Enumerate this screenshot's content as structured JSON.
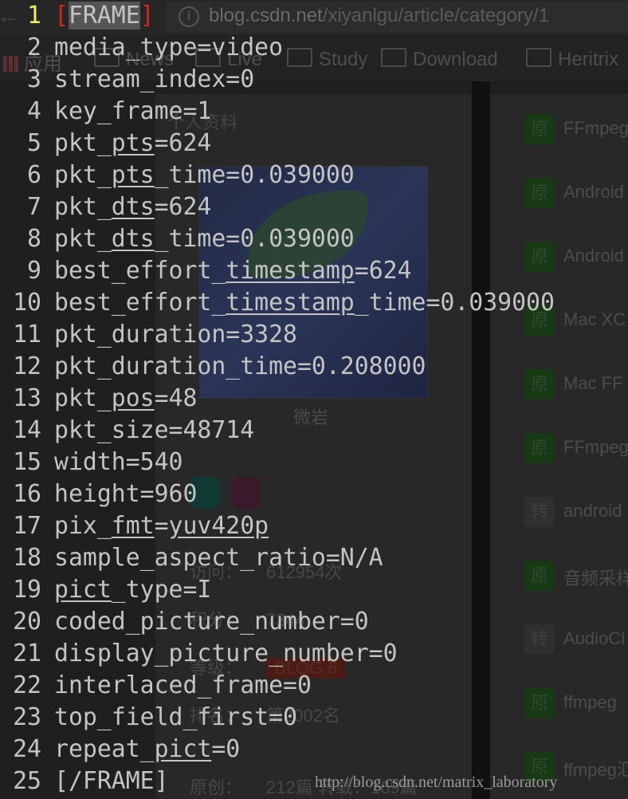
{
  "browser": {
    "url_host": "blog.csdn.net",
    "url_path": "/xiyanlgu/article/category/1",
    "bookmarks": [
      {
        "label": "应用",
        "icon": "apps-icon"
      },
      {
        "label": "News",
        "icon": "folder-icon"
      },
      {
        "label": "Live",
        "icon": "folder-icon"
      },
      {
        "label": "Study",
        "icon": "folder-icon"
      },
      {
        "label": "Download",
        "icon": "folder-icon"
      },
      {
        "label": "Heritrix",
        "icon": "folder-icon"
      }
    ],
    "profile": {
      "title": "个人资料",
      "name": "微岩",
      "stats": [
        {
          "label": "访问：",
          "value": "612954次"
        },
        {
          "label": "积分：",
          "value": "7344"
        },
        {
          "label": "等级：",
          "value": "BLOG 6"
        },
        {
          "label": "排名：",
          "value": "第2002名"
        },
        {
          "label": "原创：",
          "value": "212篇 转载：169篇"
        }
      ]
    },
    "articles": [
      {
        "badge": "原",
        "title": "FFmpeg"
      },
      {
        "badge": "原",
        "title": "Android"
      },
      {
        "badge": "原",
        "title": "Android"
      },
      {
        "badge": "原",
        "title": "Mac XC"
      },
      {
        "badge": "原",
        "title": "Mac FF"
      },
      {
        "badge": "原",
        "title": "FFmpeg"
      },
      {
        "badge": "转",
        "title": "android"
      },
      {
        "badge": "原",
        "title": "音频采样"
      },
      {
        "badge": "转",
        "title": "AudioCl"
      },
      {
        "badge": "原",
        "title": "ffmpeg"
      },
      {
        "badge": "原",
        "title": "ffmpeg汇"
      }
    ],
    "watermark": "http://blog.csdn.net/matrix_laboratory"
  },
  "editor": {
    "current_line": 1,
    "lines": [
      [
        {
          "t": "[",
          "c": "br"
        },
        {
          "t": "FRAME",
          "c": "hl"
        },
        {
          "t": "]",
          "c": "br"
        }
      ],
      [
        {
          "t": "media_type=video"
        }
      ],
      [
        {
          "t": "stream_index=0"
        }
      ],
      [
        {
          "t": "key_frame=1"
        }
      ],
      [
        {
          "t": "pkt_"
        },
        {
          "t": "pts",
          "c": "u"
        },
        {
          "t": "=624"
        }
      ],
      [
        {
          "t": "pkt_"
        },
        {
          "t": "pts",
          "c": "u"
        },
        {
          "t": "_time=0.039000"
        }
      ],
      [
        {
          "t": "pkt_"
        },
        {
          "t": "dts",
          "c": "u"
        },
        {
          "t": "=624"
        }
      ],
      [
        {
          "t": "pkt_"
        },
        {
          "t": "dts",
          "c": "u"
        },
        {
          "t": "_time=0.039000"
        }
      ],
      [
        {
          "t": "best_effort_"
        },
        {
          "t": "timestamp",
          "c": "u"
        },
        {
          "t": "=624"
        }
      ],
      [
        {
          "t": "best_effort_"
        },
        {
          "t": "timestamp",
          "c": "u"
        },
        {
          "t": "_time=0.039000"
        }
      ],
      [
        {
          "t": "pkt_duration=3328"
        }
      ],
      [
        {
          "t": "pkt_duration_time=0.208000"
        }
      ],
      [
        {
          "t": "pkt_"
        },
        {
          "t": "pos",
          "c": "u"
        },
        {
          "t": "=48"
        }
      ],
      [
        {
          "t": "pkt_size=48714"
        }
      ],
      [
        {
          "t": "width=540"
        }
      ],
      [
        {
          "t": "height=960"
        }
      ],
      [
        {
          "t": "pix_"
        },
        {
          "t": "fmt",
          "c": "u"
        },
        {
          "t": "="
        },
        {
          "t": "yuv420p",
          "c": "u"
        }
      ],
      [
        {
          "t": "sample_aspect_ratio=N/A"
        }
      ],
      [
        {
          "t": "pict",
          "c": "u"
        },
        {
          "t": "_type=I"
        }
      ],
      [
        {
          "t": "coded_picture_number=0"
        }
      ],
      [
        {
          "t": "display_picture_number=0"
        }
      ],
      [
        {
          "t": "interlaced_frame=0"
        }
      ],
      [
        {
          "t": "top_field_first=0"
        }
      ],
      [
        {
          "t": "repeat_"
        },
        {
          "t": "pict",
          "c": "u"
        },
        {
          "t": "=0"
        }
      ],
      [
        {
          "t": "[/FRAME]"
        }
      ]
    ]
  },
  "colors": {
    "background": "#1f1f1f",
    "text": "#c4c4c4",
    "current_line_number": "#f0f060",
    "bracket": "#d02a20",
    "badge_original": "#173a14"
  }
}
